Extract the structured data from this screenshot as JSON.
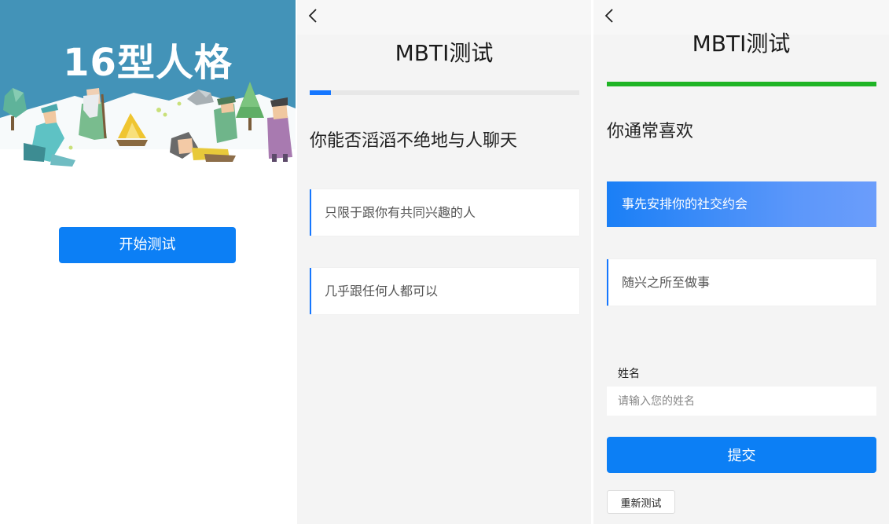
{
  "splash": {
    "title": "16型人格",
    "start_button": "开始测试",
    "colors": {
      "sky": "#4393b8",
      "snow": "#ffffff",
      "button": "#0c7ff5"
    }
  },
  "question_screen": {
    "nav_back_icon": "chevron-left-icon",
    "title": "MBTI测试",
    "progress": 0.08,
    "question": "你能否滔滔不绝地与人聊天",
    "options": [
      {
        "label": "只限于跟你有共同兴趣的人",
        "selected": false
      },
      {
        "label": "几乎跟任何人都可以",
        "selected": false
      }
    ],
    "colors": {
      "progress": "#1677ff",
      "accent": "#1677ff"
    }
  },
  "final_screen": {
    "nav_back_icon": "chevron-left-icon",
    "title": "MBTI测试",
    "progress": 1.0,
    "question": "你通常喜欢",
    "options": [
      {
        "label": "事先安排你的社交约会",
        "selected": true
      },
      {
        "label": "随兴之所至做事",
        "selected": false
      }
    ],
    "name_label": "姓名",
    "name_placeholder": "请输入您的姓名",
    "name_value": "",
    "submit_button": "提交",
    "restart_button": "重新测试",
    "colors": {
      "progress": "#1fb425",
      "selected_gradient_start": "#1a7ff6",
      "selected_gradient_end": "#6b9dfb"
    }
  }
}
